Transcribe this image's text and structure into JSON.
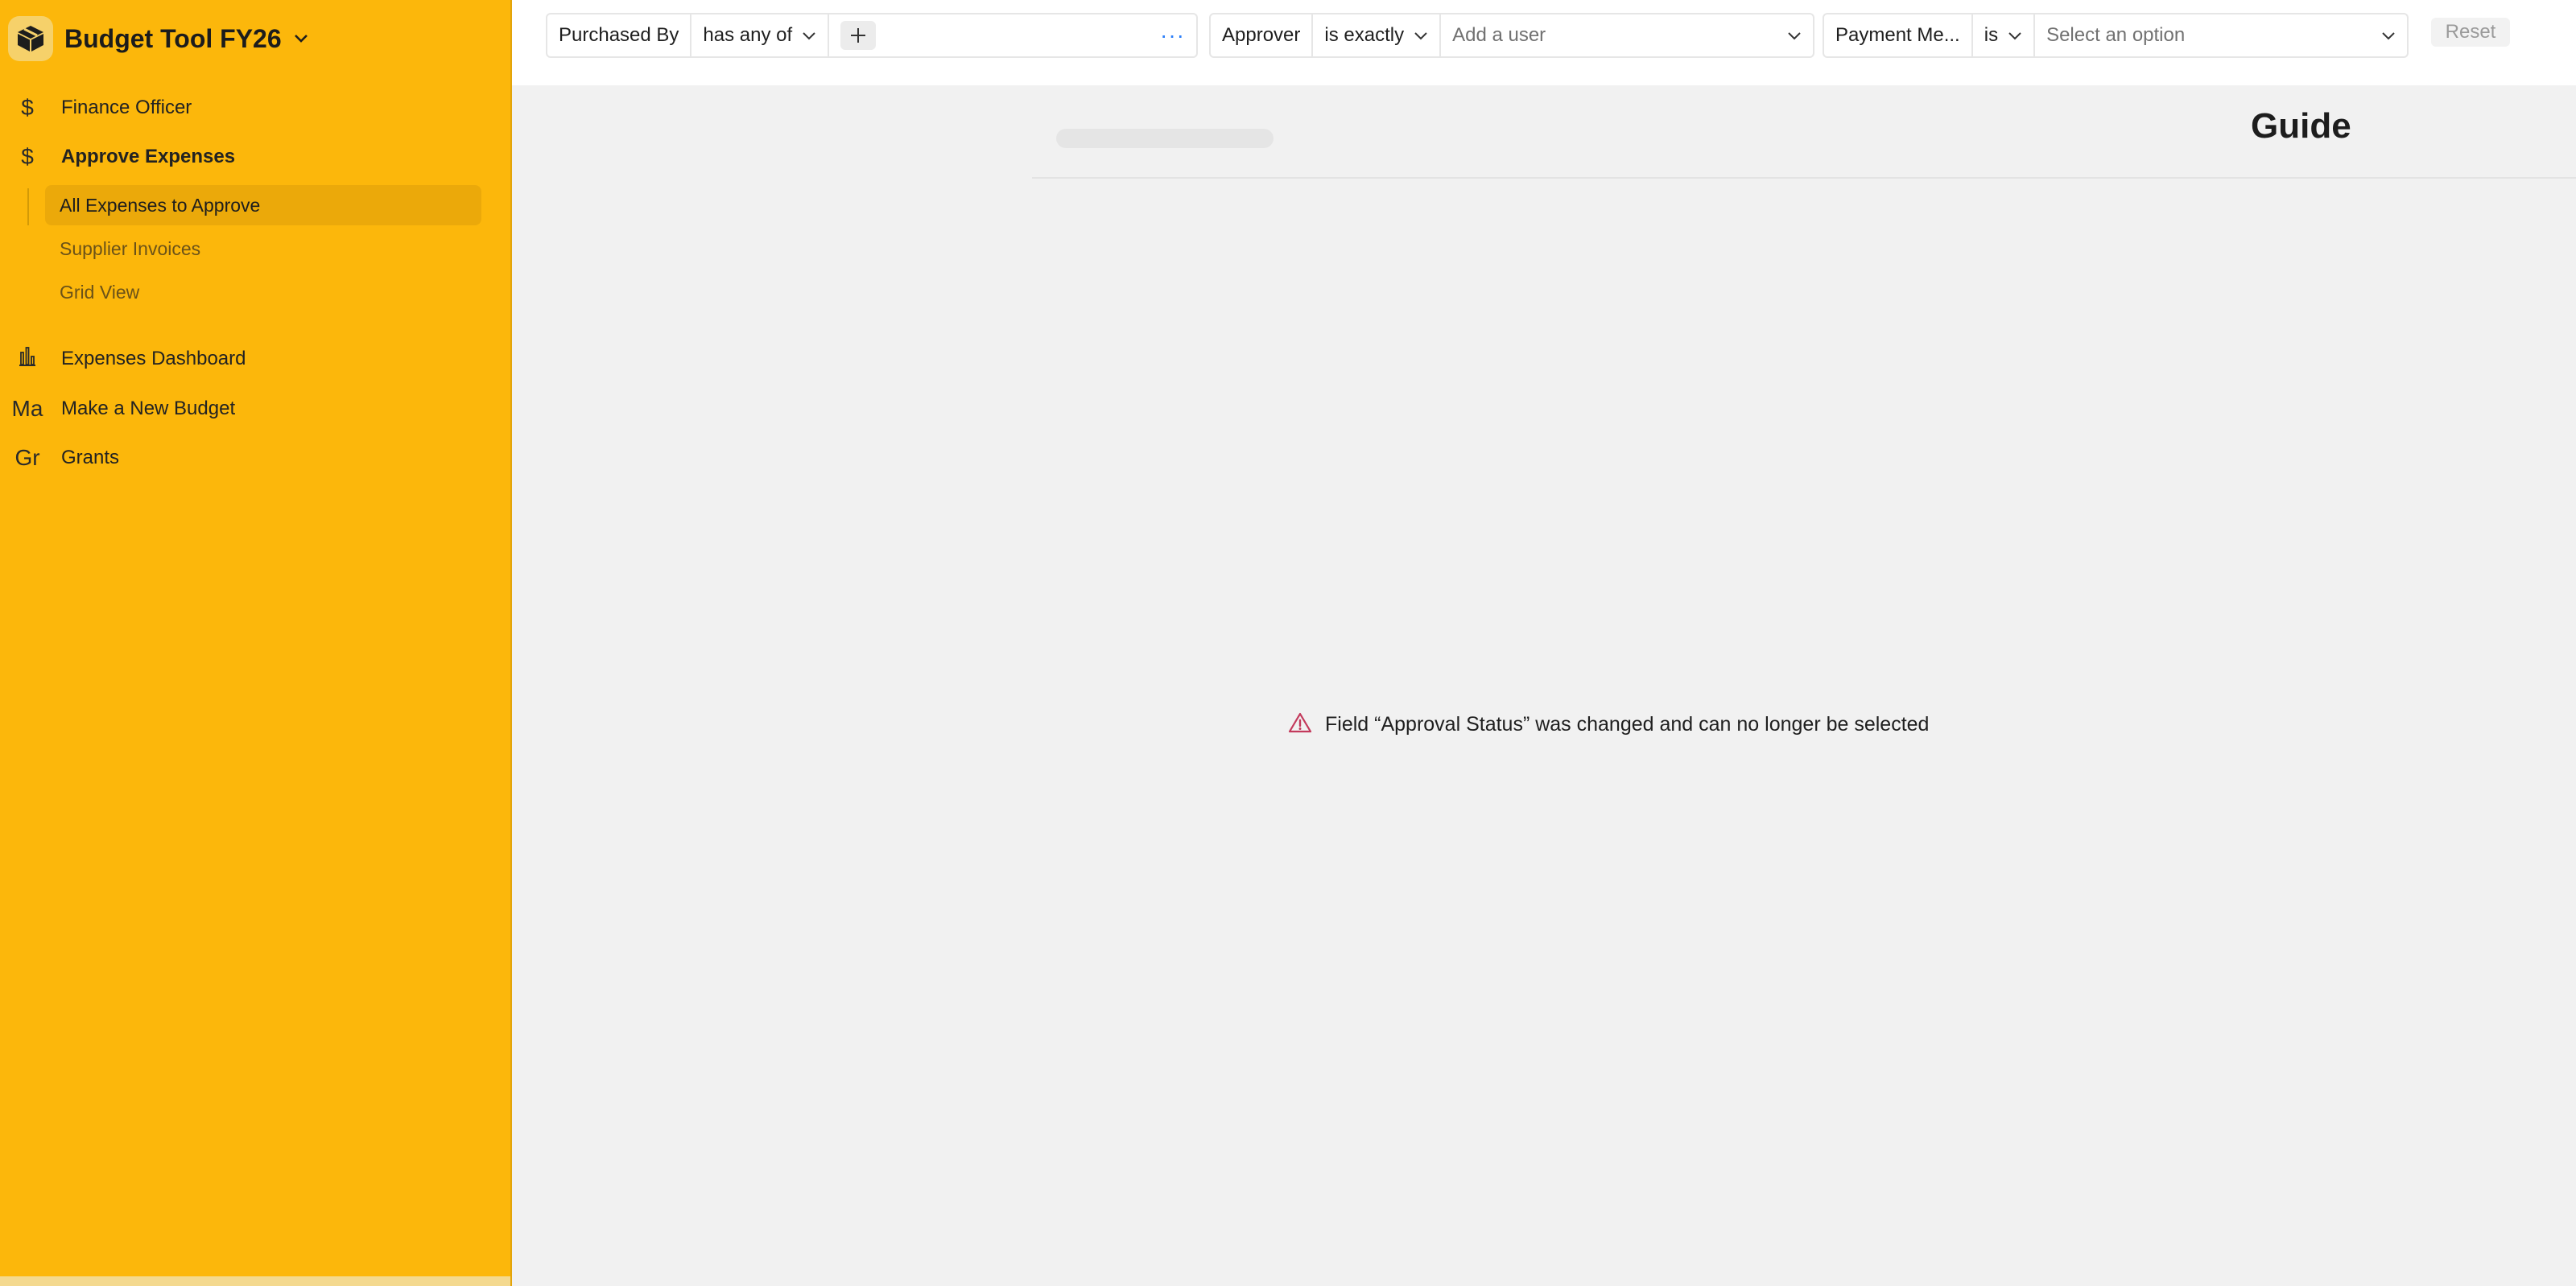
{
  "app": {
    "title": "Budget Tool FY26",
    "logo_icon": "cube-box-icon"
  },
  "sidebar": {
    "items": [
      {
        "label": "Finance Officer",
        "icon": "$"
      },
      {
        "label": "Approve Expenses",
        "icon": "$"
      },
      {
        "label": "Expenses Dashboard",
        "icon": "bar-chart-icon"
      },
      {
        "label": "Make a New Budget",
        "icon": "Ma"
      },
      {
        "label": "Grants",
        "icon": "Gr"
      }
    ],
    "subitems": [
      {
        "label": "All Expenses to Approve",
        "active": true
      },
      {
        "label": "Supplier Invoices",
        "active": false
      },
      {
        "label": "Grid View",
        "active": false
      }
    ]
  },
  "filters": {
    "purchased_by": {
      "field": "Purchased By",
      "operator": "has any of",
      "more": "···"
    },
    "approver": {
      "field": "Approver",
      "operator": "is exactly",
      "placeholder": "Add a user"
    },
    "payment_method": {
      "field": "Payment Me...",
      "operator": "is",
      "placeholder": "Select an option"
    },
    "reset_label": "Reset"
  },
  "main": {
    "guide_title": "Guide",
    "error_message": "Field “Approval Status” was changed and can no longer be selected"
  },
  "colors": {
    "sidebar_bg": "#fcb70b",
    "active_item_bg": "#eba90a",
    "error_icon": "#c33a5c",
    "accent_blue": "#2d7ff9"
  }
}
